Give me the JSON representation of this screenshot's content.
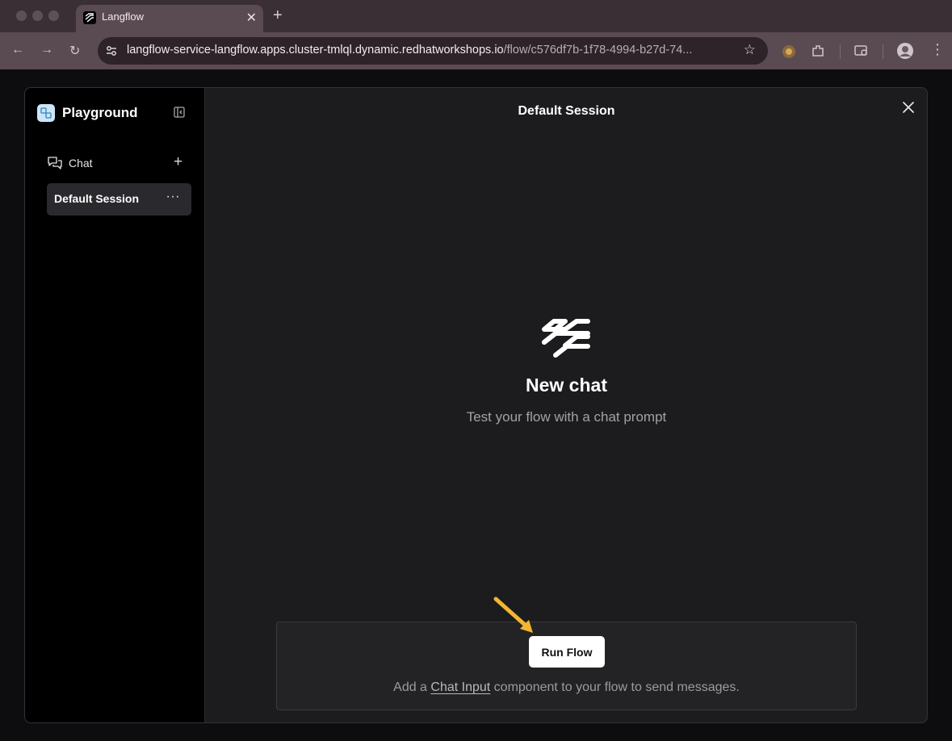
{
  "browser": {
    "tab_title": "Langflow",
    "tab_close": "✕",
    "new_tab": "+",
    "url_host": "langflow-service-langflow.apps.cluster-tmlql.dynamic.redhatworkshops.io",
    "url_path": "/flow/c576df7b-1f78-4994-b27d-74...",
    "star": "☆"
  },
  "sidebar": {
    "title": "Playground",
    "section_label": "Chat",
    "add_label": "+",
    "sessions": [
      {
        "label": "Default Session",
        "more": "···"
      }
    ]
  },
  "main": {
    "session_title": "Default Session",
    "empty_title": "New chat",
    "empty_subtitle": "Test your flow with a chat prompt",
    "run_button": "Run Flow",
    "hint_prefix": "Add a ",
    "hint_link": "Chat Input",
    "hint_suffix": " component to your flow to send messages."
  },
  "colors": {
    "annotation_arrow": "#f2b632",
    "logo_bg": "#c9e7f8"
  }
}
